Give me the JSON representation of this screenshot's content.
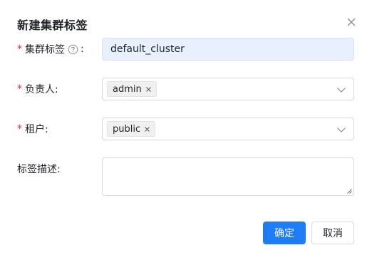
{
  "modal": {
    "title": "新建集群标签",
    "close_icon": "close-icon"
  },
  "form": {
    "cluster_tag": {
      "required_mark": "*",
      "label": "集群标签",
      "help_icon": "question-circle-icon",
      "colon": ":",
      "value": "default_cluster"
    },
    "owner": {
      "required_mark": "*",
      "label": "负责人:",
      "tags": [
        "admin"
      ],
      "dropdown_icon": "chevron-down-icon"
    },
    "tenant": {
      "required_mark": "*",
      "label": "租户:",
      "tags": [
        "public"
      ],
      "dropdown_icon": "chevron-down-icon"
    },
    "description": {
      "label": "标签描述:",
      "value": ""
    }
  },
  "footer": {
    "confirm_label": "确定",
    "cancel_label": "取消"
  },
  "colors": {
    "primary": "#1f7cf5",
    "required": "#f5222d",
    "input_filled_bg": "#e8f0fe"
  }
}
